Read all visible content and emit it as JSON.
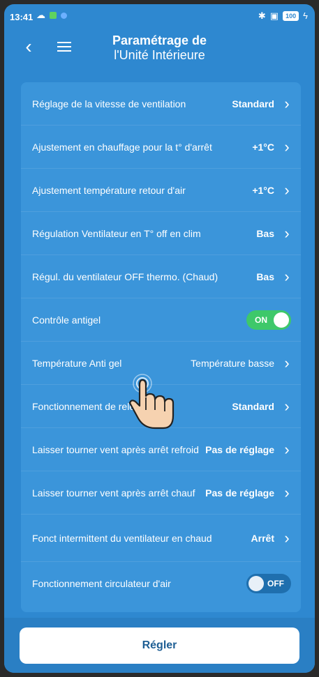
{
  "status_bar": {
    "time": "13:41",
    "battery": "100"
  },
  "header": {
    "title_line1": "Paramétrage de",
    "title_line2": "l'Unité Intérieure"
  },
  "settings": [
    {
      "label": "Réglage de la vitesse de ventilation",
      "value": "Standard",
      "type": "select"
    },
    {
      "label": "Ajustement en chauffage pour la t° d'arrêt",
      "value": "+1°C",
      "type": "select"
    },
    {
      "label": "Ajustement température retour d'air",
      "value": "+1°C",
      "type": "select"
    },
    {
      "label": "Régulation Ventilateur en T° off en clim",
      "value": "Bas",
      "type": "select"
    },
    {
      "label": "Régul. du ventilateur OFF thermo. (Chaud)",
      "value": "Bas",
      "type": "select"
    },
    {
      "label": "Contrôle antigel",
      "value": "ON",
      "type": "toggle",
      "state": true
    },
    {
      "label": "Température Anti gel",
      "value": "Température basse",
      "type": "select"
    },
    {
      "label": "Fonctionnement de relevage",
      "value": "Standard",
      "type": "select"
    },
    {
      "label": "Laisser tourner vent après arrêt refroid",
      "value": "Pas de réglage",
      "type": "select"
    },
    {
      "label": "Laisser tourner vent après arrêt chauf",
      "value": "Pas de réglage",
      "type": "select"
    },
    {
      "label": "Fonct intermittent du ventilateur en chaud",
      "value": "Arrêt",
      "type": "select"
    },
    {
      "label": "Fonctionnement circulateur d'air",
      "value": "OFF",
      "type": "toggle",
      "state": false
    }
  ],
  "apply_button": {
    "label": "Régler"
  },
  "colors": {
    "background": "#2e88d0",
    "card": "#3b95da",
    "toggle_on": "#3ec86a",
    "toggle_off": "#1f6fae"
  }
}
